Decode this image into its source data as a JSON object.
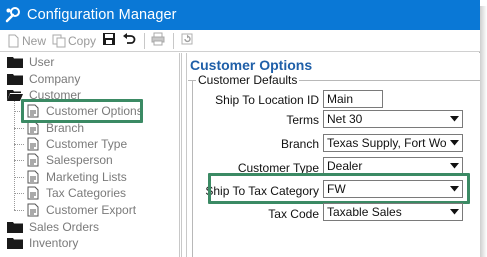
{
  "window": {
    "title": "Configuration Manager"
  },
  "toolbar": {
    "new_label": "New",
    "copy_label": "Copy",
    "icons": [
      "new-icon",
      "copy-icon",
      "save-icon",
      "undo-icon",
      "print-icon",
      "refresh-icon"
    ]
  },
  "tree": {
    "items": [
      {
        "label": "User",
        "type": "folder"
      },
      {
        "label": "Company",
        "type": "folder"
      },
      {
        "label": "Customer",
        "type": "folder"
      },
      {
        "label": "Customer Options",
        "type": "doc",
        "selected": true
      },
      {
        "label": "Branch",
        "type": "doc"
      },
      {
        "label": "Customer Type",
        "type": "doc"
      },
      {
        "label": "Salesperson",
        "type": "doc"
      },
      {
        "label": "Marketing Lists",
        "type": "doc"
      },
      {
        "label": "Tax Categories",
        "type": "doc"
      },
      {
        "label": "Customer Export",
        "type": "doc"
      },
      {
        "label": "Sales Orders",
        "type": "folder"
      },
      {
        "label": "Inventory",
        "type": "folder"
      }
    ]
  },
  "panel": {
    "title": "Customer Options",
    "group_label": "Customer Defaults",
    "fields": {
      "ship_to_location_id": {
        "label": "Ship To Location ID",
        "value": "Main"
      },
      "terms": {
        "label": "Terms",
        "value": "Net 30"
      },
      "branch": {
        "label": "Branch",
        "value": "Texas Supply, Fort Worth"
      },
      "customer_type": {
        "label": "Customer Type",
        "value": "Dealer"
      },
      "ship_to_tax_category": {
        "label": "Ship To Tax Category",
        "value": "FW"
      },
      "tax_code": {
        "label": "Tax Code",
        "value": "Taxable Sales"
      }
    }
  },
  "colors": {
    "titlebar": "#0a78d6",
    "highlight": "#3b8a64",
    "panel_title": "#1f5fa8"
  }
}
